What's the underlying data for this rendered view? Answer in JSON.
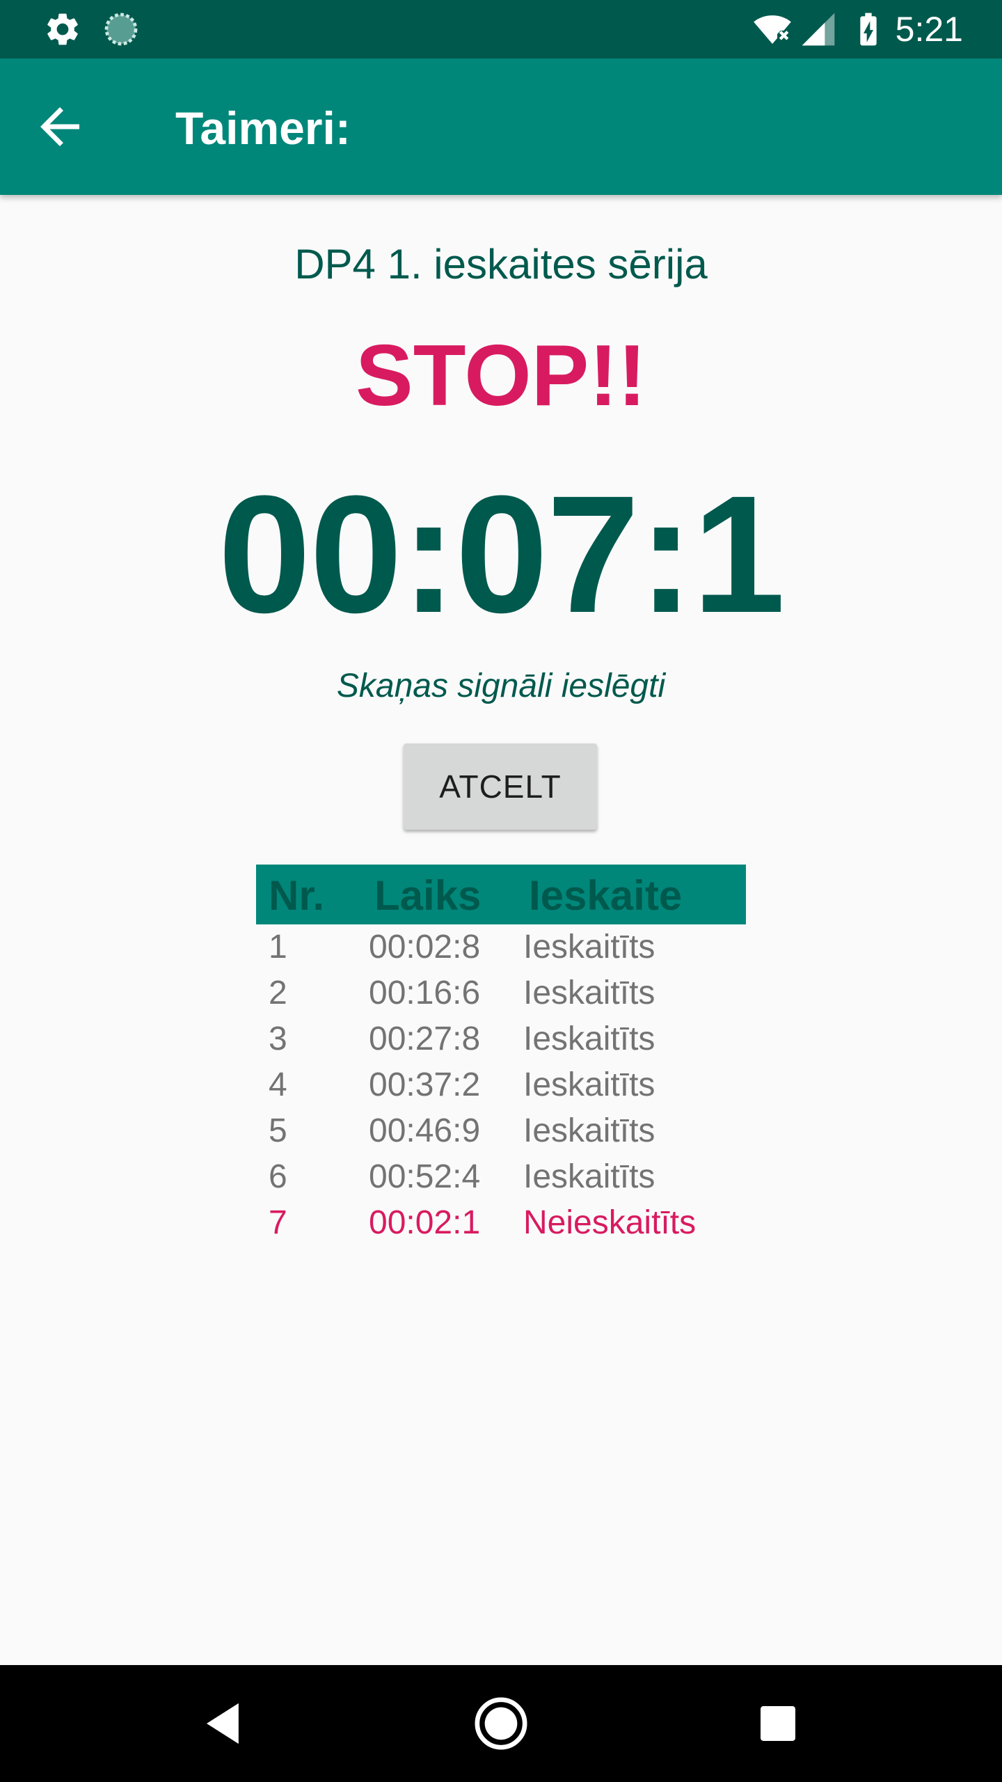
{
  "status_bar": {
    "time": "5:21",
    "icons": [
      "settings-icon",
      "sync-icon",
      "wifi-icon",
      "signal-icon",
      "battery-charging-icon"
    ]
  },
  "app_bar": {
    "title": "Taimeri:",
    "back_icon": "arrow-back-icon"
  },
  "main": {
    "series_title": "DP4 1. ieskaites sērija",
    "stop_label": "STOP!!",
    "timer": "00:07:1",
    "sound_status": "Skaņas signāli ieslēgti",
    "cancel_button": "ATCELT"
  },
  "table": {
    "headers": [
      "Nr.",
      "Laiks",
      "Ieskaite"
    ],
    "rows": [
      {
        "nr": "1",
        "time": "00:02:8",
        "status": "Ieskaitīts"
      },
      {
        "nr": "2",
        "time": "00:16:6",
        "status": "Ieskaitīts"
      },
      {
        "nr": "3",
        "time": "00:27:8",
        "status": "Ieskaitīts"
      },
      {
        "nr": "4",
        "time": "00:37:2",
        "status": "Ieskaitīts"
      },
      {
        "nr": "5",
        "time": "00:46:9",
        "status": "Ieskaitīts"
      },
      {
        "nr": "6",
        "time": "00:52:4",
        "status": "Ieskaitīts"
      },
      {
        "nr": "7",
        "time": "00:02:1",
        "status": "Neieskaitīts"
      }
    ]
  },
  "nav_bar": {
    "icons": [
      "nav-back-icon",
      "nav-home-icon",
      "nav-recents-icon"
    ]
  },
  "colors": {
    "status_bar": "#00594d",
    "app_bar": "#00877a",
    "accent": "#d81b60",
    "primary_dark": "#00594d",
    "muted_text": "#737373"
  }
}
